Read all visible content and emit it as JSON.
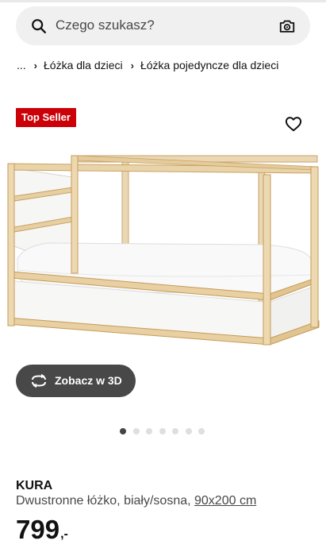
{
  "search": {
    "placeholder": "Czego szukasz?"
  },
  "breadcrumb": [
    {
      "label": "..."
    },
    {
      "label": "Łóżka dla dzieci"
    },
    {
      "label": "Łóżka pojedyncze dla dzieci"
    }
  ],
  "badge": {
    "label": "Top Seller",
    "color": "#cc0008"
  },
  "favorite": {
    "icon": "heart-icon"
  },
  "viewer": {
    "button_label": "Zobacz w 3D",
    "icon": "rotate-3d-icon"
  },
  "carousel": {
    "total": 7,
    "active": 1
  },
  "product": {
    "name": "KURA",
    "description": "Dwustronne łóżko, biały/sosna, ",
    "size": "90x200 cm",
    "price_integer": "799",
    "price_decimal": ",-"
  }
}
